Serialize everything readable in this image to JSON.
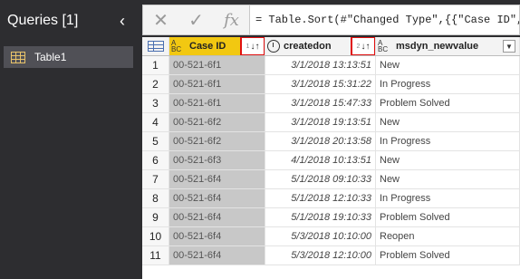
{
  "queries": {
    "title": "Queries [1]",
    "collapse_icon": "chevron-left-icon",
    "items": [
      {
        "label": "Table1",
        "icon": "table-icon"
      }
    ]
  },
  "formula_bar": {
    "cancel_glyph": "✕",
    "commit_glyph": "✓",
    "fx_glyph": "fx",
    "formula": "= Table.Sort(#\"Changed Type\",{{\"Case ID\", Ord"
  },
  "grid": {
    "columns": [
      {
        "name": "Case ID",
        "type_icon": "abc-type-icon",
        "sort_order": "1",
        "sort_direction": "ascending"
      },
      {
        "name": "createdon",
        "type_icon": "datetime-type-icon",
        "sort_order": "2",
        "sort_direction": "ascending"
      },
      {
        "name": "msdyn_newvalue",
        "type_icon": "abc-type-icon"
      }
    ],
    "rows": [
      {
        "n": "1",
        "case_id": "00-521-6f1",
        "createdon": "3/1/2018 13:13:51",
        "value": "New"
      },
      {
        "n": "2",
        "case_id": "00-521-6f1",
        "createdon": "3/1/2018 15:31:22",
        "value": "In Progress"
      },
      {
        "n": "3",
        "case_id": "00-521-6f1",
        "createdon": "3/1/2018 15:47:33",
        "value": "Problem Solved"
      },
      {
        "n": "4",
        "case_id": "00-521-6f2",
        "createdon": "3/1/2018 19:13:51",
        "value": "New"
      },
      {
        "n": "5",
        "case_id": "00-521-6f2",
        "createdon": "3/1/2018 20:13:58",
        "value": "In Progress"
      },
      {
        "n": "6",
        "case_id": "00-521-6f3",
        "createdon": "4/1/2018 10:13:51",
        "value": "New"
      },
      {
        "n": "7",
        "case_id": "00-521-6f4",
        "createdon": "5/1/2018 09:10:33",
        "value": "New"
      },
      {
        "n": "8",
        "case_id": "00-521-6f4",
        "createdon": "5/1/2018 12:10:33",
        "value": "In Progress"
      },
      {
        "n": "9",
        "case_id": "00-521-6f4",
        "createdon": "5/1/2018 19:10:33",
        "value": "Problem Solved"
      },
      {
        "n": "10",
        "case_id": "00-521-6f4",
        "createdon": "5/3/2018 10:10:00",
        "value": "Reopen"
      },
      {
        "n": "11",
        "case_id": "00-521-6f4",
        "createdon": "5/3/2018 12:10:00",
        "value": "Problem Solved"
      }
    ]
  }
}
